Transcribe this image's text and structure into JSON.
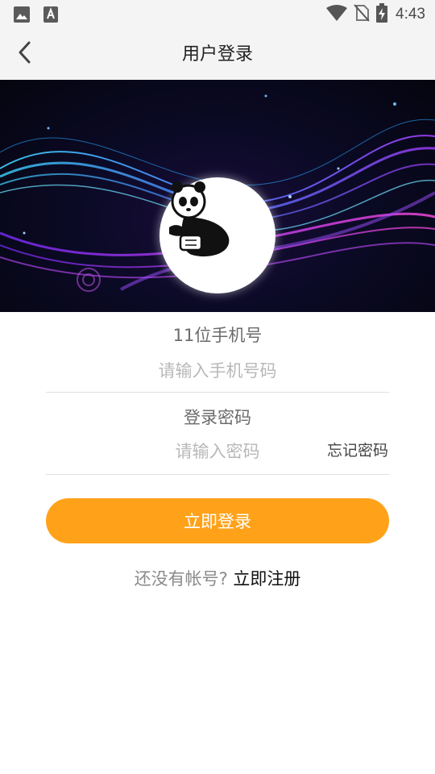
{
  "status_bar": {
    "time": "4:43",
    "left_icons": [
      "image-icon",
      "font-download-icon"
    ],
    "right_icons": [
      "wifi-icon",
      "no-sim-icon",
      "battery-charging-icon"
    ]
  },
  "app_bar": {
    "title": "用户登录",
    "back_icon": "chevron-left-icon"
  },
  "banner": {
    "avatar_icon": "panda-logo-icon"
  },
  "form": {
    "phone": {
      "label": "11位手机号",
      "placeholder": "请输入手机号码",
      "value": ""
    },
    "password": {
      "label": "登录密码",
      "placeholder": "请输入密码",
      "value": ""
    },
    "forgot_label": "忘记密码",
    "login_label": "立即登录",
    "register_prompt": "还没有帐号? ",
    "register_label": "立即注册"
  },
  "colors": {
    "accent": "#ffa21a",
    "app_bar_bg": "#f4f4f4"
  }
}
